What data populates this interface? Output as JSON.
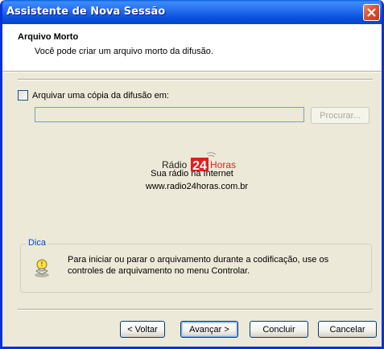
{
  "window": {
    "title": "Assistente de Nova Sessão"
  },
  "header": {
    "title": "Arquivo Morto",
    "subtitle": "Você pode criar um arquivo morto da difusão."
  },
  "archive": {
    "checkbox_label": "Arquivar uma cópia da difusão em:",
    "checked": false,
    "path_value": "",
    "browse_label": "Procurar..."
  },
  "logo": {
    "word1": "Rádio",
    "number": "24",
    "word2": "Horas"
  },
  "radio": {
    "tagline": "Sua rádio na Internet",
    "url": "www.radio24horas.com.br"
  },
  "tip": {
    "legend": "Dica",
    "text": "Para iniciar ou parar o arquivamento durante a codificação, use os controles de arquivamento no menu Controlar."
  },
  "buttons": {
    "back": "< Voltar",
    "next": "Avançar >",
    "finish": "Concluir",
    "cancel": "Cancelar"
  },
  "colors": {
    "title_bar": "#0a55e0",
    "accent_link": "#0046d5",
    "logo_red": "#e02020"
  },
  "icons": {
    "close": "close-icon",
    "tip": "lightbulb-tip-icon"
  }
}
